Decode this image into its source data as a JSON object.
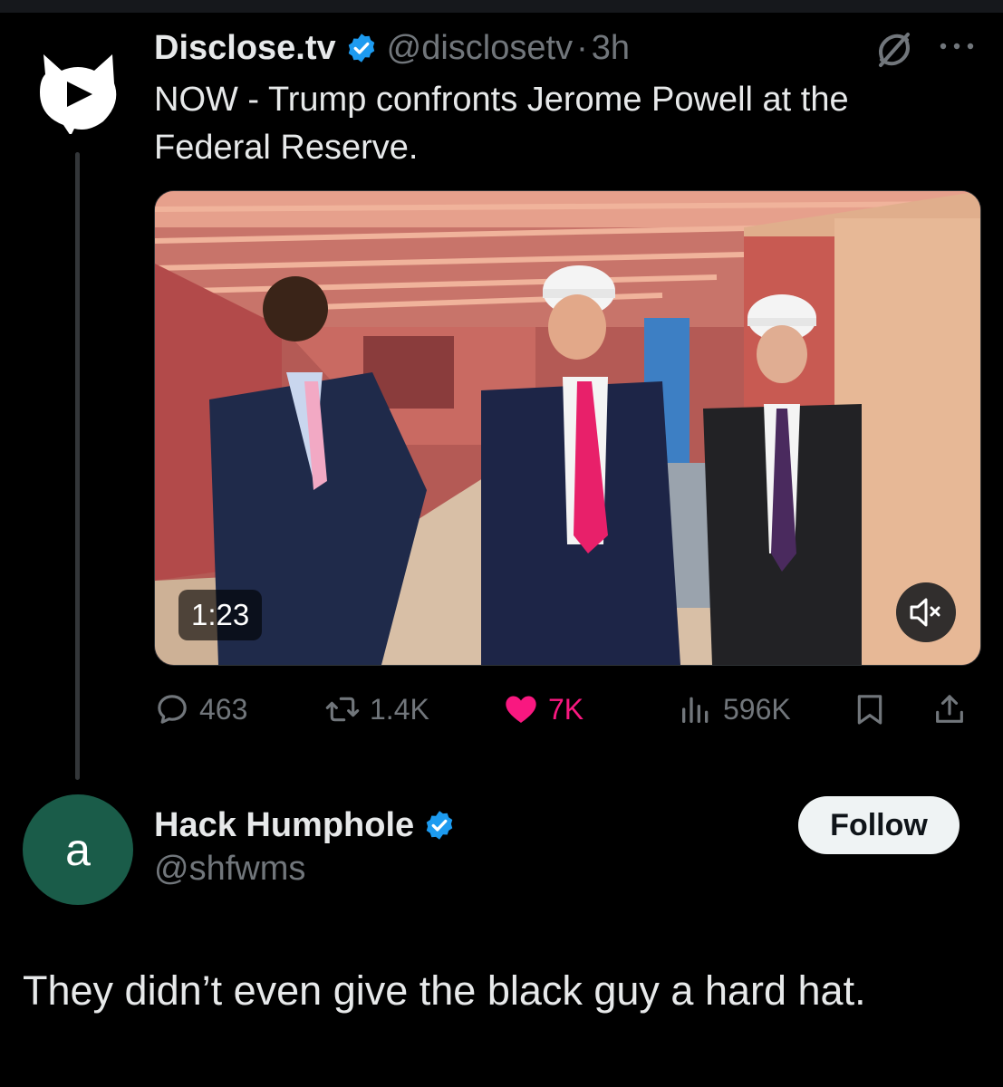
{
  "post": {
    "author_name": "Disclose.tv",
    "handle": "@disclosetv",
    "separator": "·",
    "time": "3h",
    "text": "NOW - Trump confronts Jerome Powell at the Federal Reserve.",
    "media": {
      "duration": "1:23",
      "muted": true
    },
    "stats": {
      "replies": "463",
      "retweets": "1.4K",
      "likes": "7K",
      "views": "596K"
    },
    "liked": true
  },
  "reply": {
    "avatar_letter": "a",
    "author_name": "Hack Humphole",
    "handle": "@shfwms",
    "follow_label": "Follow",
    "text": "They didn’t even give the black guy a hard hat."
  },
  "icons": [
    "disclosetv-logo-icon",
    "verified-badge-icon",
    "grok-icon",
    "more-icon",
    "reply-icon",
    "retweet-icon",
    "like-icon",
    "views-icon",
    "bookmark-icon",
    "share-icon",
    "mute-icon"
  ],
  "colors": {
    "background": "#000000",
    "text_primary": "#e7e9ea",
    "text_secondary": "#71767b",
    "verified_blue": "#1d9bf0",
    "like_pink": "#f91880",
    "reply_avatar_bg": "#1a5c49"
  }
}
